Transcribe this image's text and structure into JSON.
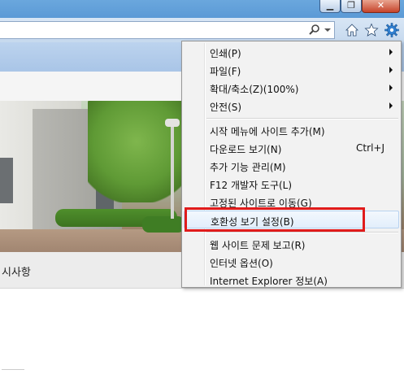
{
  "window": {
    "min_label": "▁",
    "max_label": "❐",
    "close_label": "✕"
  },
  "toolbar": {
    "icons": [
      "search-icon",
      "home-icon",
      "favorites-star-icon",
      "tools-gear-icon"
    ]
  },
  "page": {
    "notice_text": "시사항"
  },
  "menu": {
    "items": [
      {
        "label": "인쇄(P)",
        "submenu": true
      },
      {
        "label": "파일(F)",
        "submenu": true
      },
      {
        "label": "확대/축소(Z)(100%)",
        "submenu": true
      },
      {
        "label": "안전(S)",
        "submenu": true
      },
      {
        "label": "시작 메뉴에 사이트 추가(M)"
      },
      {
        "label": "다운로드 보기(N)",
        "shortcut": "Ctrl+J"
      },
      {
        "label": "추가 기능 관리(M)"
      },
      {
        "label": "F12 개발자 도구(L)"
      },
      {
        "label": "고정된 사이트로 이동(G)"
      },
      {
        "label": "호환성 보기 설정(B)",
        "highlighted": true
      },
      {
        "label": "웹 사이트 문제 보고(R)"
      },
      {
        "label": "인터넷 옵션(O)"
      },
      {
        "label": "Internet Explorer 정보(A)"
      }
    ]
  },
  "colors": {
    "highlight_box": "#e01b1b",
    "chrome_blue": "#5b9ad6"
  }
}
